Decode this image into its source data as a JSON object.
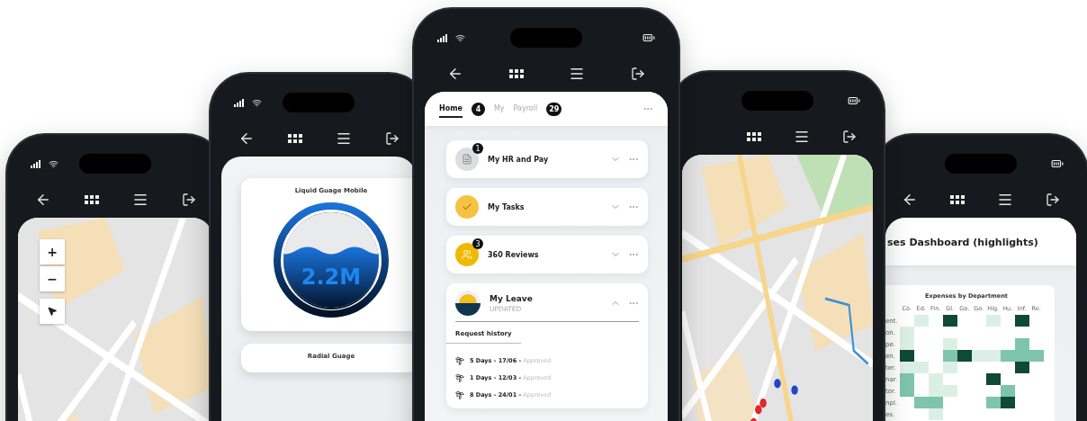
{
  "phones": [
    {
      "kind": "map",
      "signal_icons": true,
      "battery_icon": false,
      "back_icon": true,
      "map_controls": [
        "+",
        "−"
      ]
    },
    {
      "kind": "gauges",
      "signal_icons": true,
      "battery_icon": false,
      "back_icon": true,
      "cards": [
        {
          "title": "Liquid Guage Mobile",
          "value": "2.2M",
          "level": 0.6
        },
        {
          "title": "Radial Guage"
        }
      ]
    },
    {
      "kind": "home",
      "signal_icons": true,
      "battery_icon": true,
      "back_icon": true,
      "tabs": [
        {
          "label": "Home",
          "selected": true,
          "badge": "4"
        },
        {
          "label": "My",
          "selected": false
        },
        {
          "label": "Payroll",
          "selected": false,
          "badge": "29"
        }
      ],
      "cards": [
        {
          "kind": "hr",
          "title": "My HR and Pay",
          "badge": "1",
          "expanded": false
        },
        {
          "kind": "tasks",
          "title": "My Tasks",
          "expanded": false
        },
        {
          "kind": "reviews",
          "title": "360 Reviews",
          "badge": "3",
          "expanded": false
        }
      ],
      "leave": {
        "title": "My Leave",
        "subtitle": "UPDATED",
        "expanded": true,
        "section": "Request history",
        "requests": [
          "**5 Days - 17/06 -** Approved",
          "**1 Days - 12/03 -** Approved",
          "**8 Days - 24/01 -** Approved"
        ]
      }
    },
    {
      "kind": "map_dots",
      "signal_icons": false,
      "battery_icon": true,
      "back_icon": false
    },
    {
      "kind": "dashboard",
      "signal_icons": false,
      "battery_icon": true,
      "back_icon": true,
      "title": "ses Dashboard (highlights)",
      "chart_title": "Expenses by Department",
      "columns": [
        "Co.",
        "Ed.",
        "Fin.",
        "Gl.",
        "Go.",
        "Go.",
        "Hig.",
        "Hu.",
        "Inf.",
        "Re."
      ],
      "rows": [
        "ent.",
        "on.",
        "pe.",
        "en.",
        "ter.",
        "nar.",
        "tor.",
        "npl.",
        "es."
      ]
    }
  ]
}
